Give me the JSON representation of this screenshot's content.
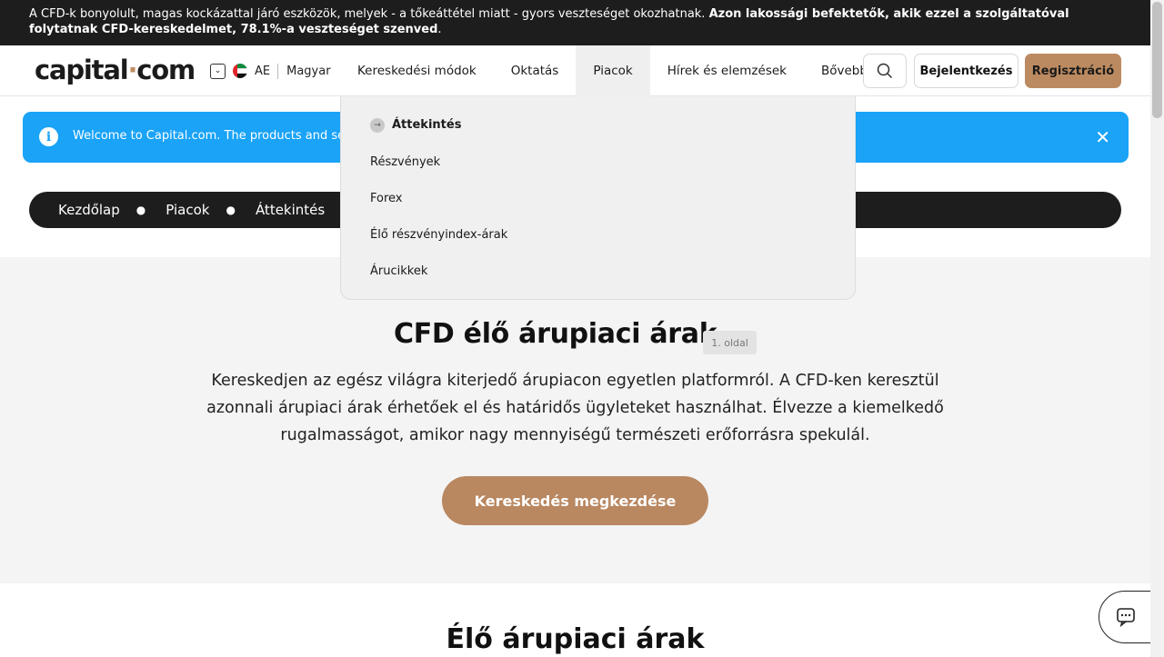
{
  "risk_warning": {
    "text": "A CFD-k bonyolult, magas kockázattal járó eszközök, melyek - a tőkeáttétel miatt - gyors veszteséget okozhatnak. ",
    "bold": "Azon lakossági befektetők, akik ezzel a szolgáltatóval folytatnak CFD-kereskedelmet, 78.1%-a veszteséget szenved",
    "end": "."
  },
  "header": {
    "logo_left": "capital",
    "logo_dot": "·",
    "logo_right": "com",
    "region_code": "AE",
    "language": "Magyar",
    "nav": [
      "Kereskedési módok",
      "Oktatás",
      "Piacok",
      "Hírek és elemzések",
      "Bővebben"
    ],
    "active_nav": "Piacok",
    "login": "Bejelentkezés",
    "register": "Regisztráció"
  },
  "dropdown": {
    "items": [
      "Áttekintés",
      "Részvények",
      "Forex",
      "Élő részvényindex-árak",
      "Árucikkek"
    ]
  },
  "welcome": {
    "message": "Welcome to Capital.com. The products and servic"
  },
  "breadcrumb": [
    "Kezdőlap",
    "Piacok",
    "Áttekintés"
  ],
  "hero": {
    "title": "CFD élő árupiaci árak",
    "page_badge": "1. oldal",
    "description": "Kereskedjen az egész világra kiterjedő árupiacon egyetlen platformról. A CFD-ken keresztül azonnali árupiaci árak érhetőek el és határidős ügyleteket használhat. Élvezze a kiemelkedő rugalmasságot, amikor nagy mennyiségű természeti erőforrásra spekulál.",
    "cta": "Kereskedés megkezdése"
  },
  "section2": {
    "title": "Élő árupiaci árak"
  },
  "colors": {
    "accent": "#bc8a60",
    "info_blue": "#1aa3f7",
    "dark": "#1d1d1d"
  }
}
